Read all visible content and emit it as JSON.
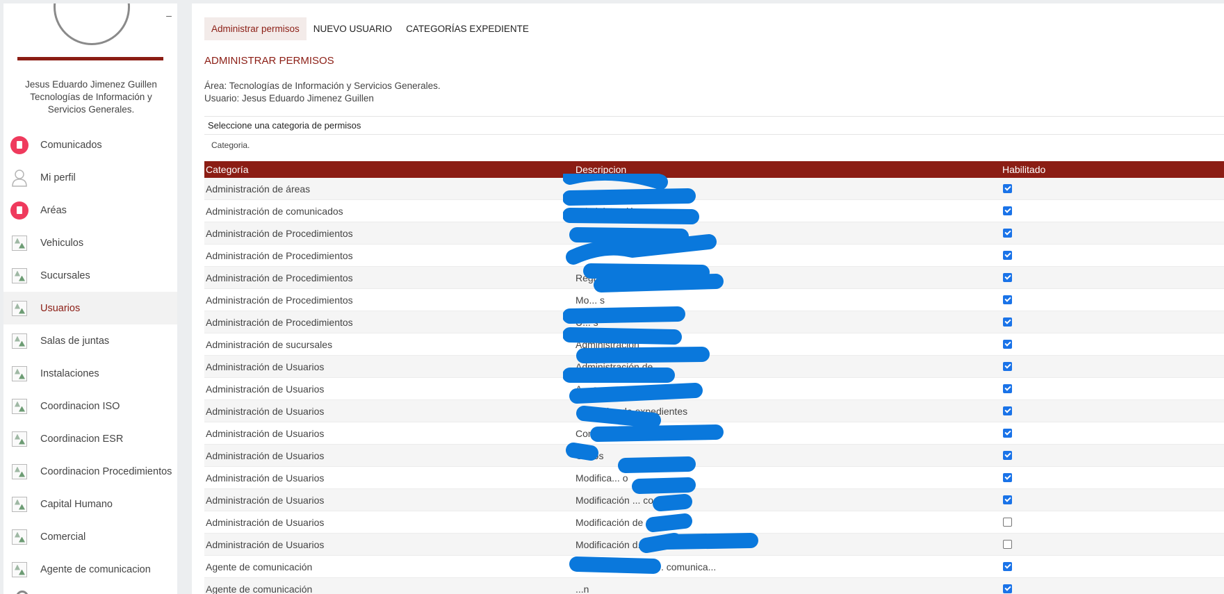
{
  "sidebar": {
    "collapse_label": "–",
    "user_name": "Jesus Eduardo Jimenez Guillen",
    "user_area": "Tecnologías de Información y Servicios Generales.",
    "items": [
      {
        "label": "Comunicados",
        "icon": "clipboard-icon"
      },
      {
        "label": "Mi perfil",
        "icon": "user-icon"
      },
      {
        "label": "Aréas",
        "icon": "clipboard-icon"
      },
      {
        "label": "Vehiculos",
        "icon": "broken-image-icon"
      },
      {
        "label": "Sucursales",
        "icon": "broken-image-icon"
      },
      {
        "label": "Usuarios",
        "icon": "broken-image-icon",
        "active": true
      },
      {
        "label": "Salas de juntas",
        "icon": "broken-image-icon"
      },
      {
        "label": "Instalaciones",
        "icon": "broken-image-icon"
      },
      {
        "label": "Coordinacion ISO",
        "icon": "broken-image-icon"
      },
      {
        "label": "Coordinacion ESR",
        "icon": "broken-image-icon"
      },
      {
        "label": "Coordinacion Procedimientos",
        "icon": "broken-image-icon"
      },
      {
        "label": "Capital Humano",
        "icon": "broken-image-icon"
      },
      {
        "label": "Comercial",
        "icon": "broken-image-icon"
      },
      {
        "label": "Agente de comunicacion",
        "icon": "broken-image-icon"
      }
    ]
  },
  "tabs": [
    {
      "label": "Administrar permisos",
      "active": true
    },
    {
      "label": "NUEVO USUARIO"
    },
    {
      "label": "CATEGORÍAS EXPEDIENTE"
    }
  ],
  "page_title": "ADMINISTRAR PERMISOS",
  "info": {
    "area": "Área: Tecnologías de Información y Servicios Generales.",
    "usuario": "Usuario: Jesus Eduardo Jimenez Guillen"
  },
  "category_selector": {
    "heading": "Seleccione una categoria de permisos",
    "value": "Categoria."
  },
  "table": {
    "headers": {
      "categoria": "Categoría",
      "descripcion": "Descripcion",
      "habilitado": "Habilitado"
    },
    "rows": [
      {
        "categoria": "Administración de áreas",
        "descripcion": "",
        "habilitado": true
      },
      {
        "categoria": "Administración de comunicados",
        "descripcion": "Administración",
        "habilitado": true
      },
      {
        "categoria": "Administración de Procedimientos",
        "descripcion": "s",
        "habilitado": true
      },
      {
        "categoria": "Administración de Procedimientos",
        "descripcion": "C",
        "habilitado": true
      },
      {
        "categoria": "Administración de Procedimientos",
        "descripcion": "Registro de ... procedimientos",
        "habilitado": true
      },
      {
        "categoria": "Administración de Procedimientos",
        "descripcion": "Mo... s",
        "habilitado": true
      },
      {
        "categoria": "Administración de Procedimientos",
        "descripcion": "U... s",
        "habilitado": true
      },
      {
        "categoria": "Administración de sucursales",
        "descripcion": "Administración",
        "habilitado": true
      },
      {
        "categoria": "Administración de Usuarios",
        "descripcion": "Administración de",
        "habilitado": true
      },
      {
        "categoria": "Administración de Usuarios",
        "descripcion": "A... s",
        "habilitado": true
      },
      {
        "categoria": "Administración de Usuarios",
        "descripcion": "...tegorías de expedientes",
        "habilitado": true
      },
      {
        "categoria": "Administración de Usuarios",
        "descripcion": "Consultar direc... s",
        "habilitado": true
      },
      {
        "categoria": "Administración de Usuarios",
        "descripcion": "C... os",
        "habilitado": true
      },
      {
        "categoria": "Administración de Usuarios",
        "descripcion": "Modifica... o",
        "habilitado": true
      },
      {
        "categoria": "Administración de Usuarios",
        "descripcion": "Modificación ... co",
        "habilitado": true
      },
      {
        "categoria": "Administración de Usuarios",
        "descripcion": "Modificación de u",
        "habilitado": false
      },
      {
        "categoria": "Administración de Usuarios",
        "descripcion": "Modificación d... o",
        "habilitado": false
      },
      {
        "categoria": "Agente de comunicación",
        "descripcion": "Administración de ... comunica...",
        "habilitado": true
      },
      {
        "categoria": "Agente de comunicación",
        "descripcion": "...n",
        "habilitado": true
      }
    ]
  },
  "colors": {
    "accent": "#8b1d14",
    "redaction": "#0a78dc",
    "icon_red": "#ef3a5d"
  }
}
